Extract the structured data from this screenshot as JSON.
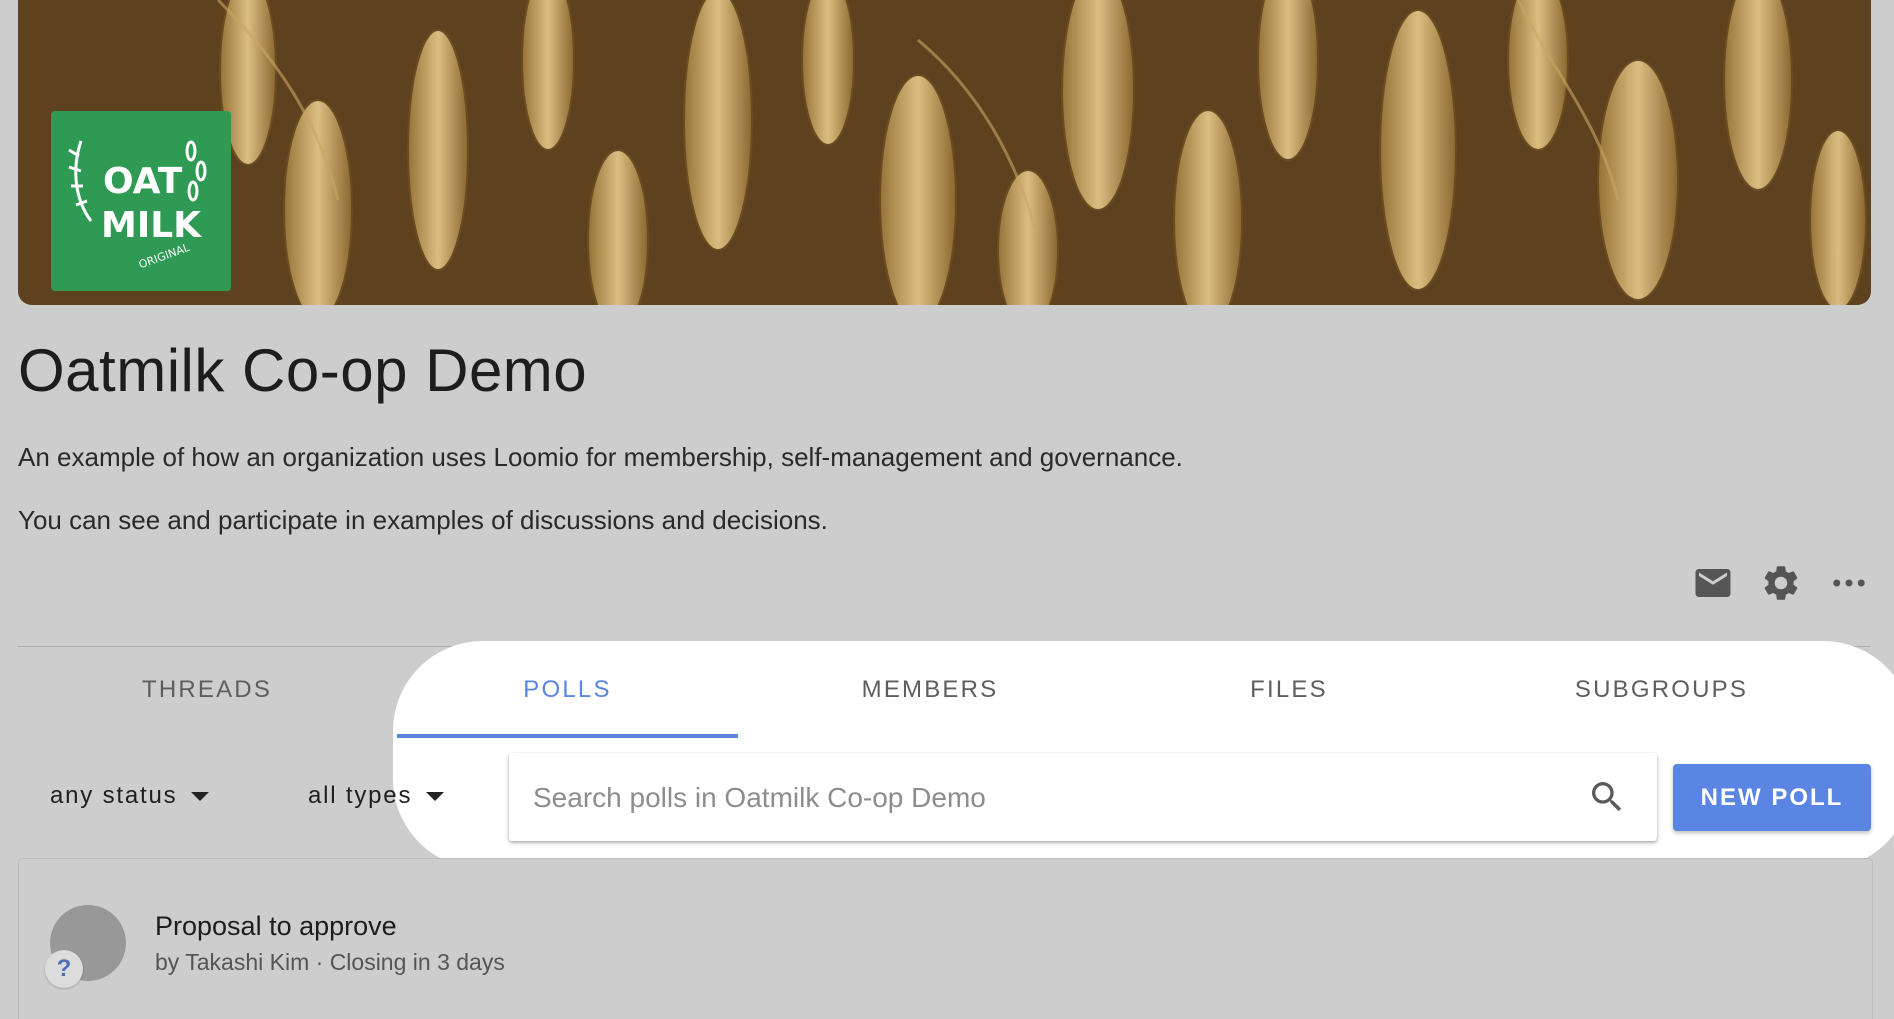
{
  "banner": {
    "logo": {
      "text_line1": "OAT",
      "text_line2": "MILK",
      "text_line3": "ORIGINAL"
    }
  },
  "group": {
    "title": "Oatmilk Co-op Demo",
    "description_1": "An example of how an organization uses Loomio for membership, self-management and governance.",
    "description_2": "You can see and participate in examples of discussions and decisions."
  },
  "actions": {
    "icons": [
      "mail-icon",
      "gear-icon",
      "more-horizontal-icon"
    ]
  },
  "tabs": [
    {
      "label": "THREADS",
      "active": false
    },
    {
      "label": "POLLS",
      "active": true
    },
    {
      "label": "MEMBERS",
      "active": false
    },
    {
      "label": "FILES",
      "active": false
    },
    {
      "label": "SUBGROUPS",
      "active": false
    }
  ],
  "filters": {
    "status": "any status",
    "type": "all types"
  },
  "search": {
    "placeholder": "Search polls in Oatmilk Co-op Demo",
    "value": ""
  },
  "new_poll_label": "NEW POLL",
  "polls": [
    {
      "title": "Proposal to approve",
      "meta": "by Takashi Kim · Closing in 3 days",
      "badge": "?"
    }
  ],
  "colors": {
    "accent": "#5b85e3",
    "background": "#cdcdcd",
    "logo_green": "#2e9a54"
  }
}
